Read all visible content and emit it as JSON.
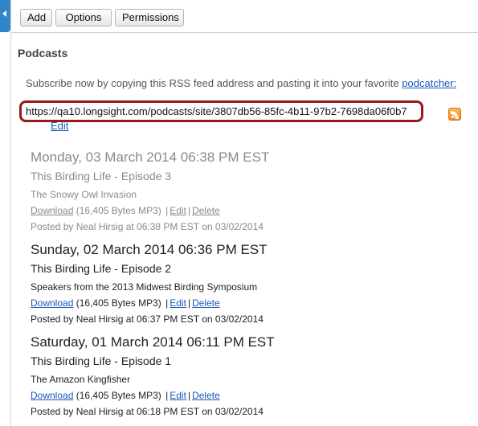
{
  "toolbar": {
    "add_label": "Add",
    "options_label": "Options",
    "permissions_label": "Permissions"
  },
  "page": {
    "title": "Podcasts"
  },
  "subscribe": {
    "text": "Subscribe now by copying this RSS feed address and pasting it into your favorite",
    "link_label": "podcatcher:",
    "feed_url": "https://qa10.longsight.com/podcasts/site/3807db56-85fc-4b11-97b2-7698da06f0b7",
    "edit_label": "Edit"
  },
  "icons": {
    "rss": "rss-feed-icon",
    "collapse": "collapse-arrow-icon"
  },
  "colors": {
    "link": "#1a57b8",
    "highlight_border": "#9b1818",
    "side_tab": "#2f86c7",
    "rss": "#ef8a1c"
  },
  "episodes": [
    {
      "date": "Monday, 03 March 2014 06:38 PM EST",
      "title": "This Birding Life - Episode 3",
      "description": "The Snowy Owl Invasion",
      "download_label": "Download",
      "size": "(16,405 Bytes MP3)",
      "edit_label": "Edit",
      "delete_label": "Delete",
      "posted": "Posted by Neal Hirsig at 06:38 PM EST on 03/02/2014"
    },
    {
      "date": "Sunday, 02 March 2014 06:36 PM EST",
      "title": "This Birding Life - Episode 2",
      "description": "Speakers from the 2013 Midwest Birding Symposium",
      "download_label": "Download",
      "size": "(16,405 Bytes MP3)",
      "edit_label": "Edit",
      "delete_label": "Delete",
      "posted": "Posted by Neal Hirsig at 06:37 PM EST on 03/02/2014"
    },
    {
      "date": "Saturday, 01 March 2014 06:11 PM EST",
      "title": "This Birding Life - Episode 1",
      "description": "The Amazon Kingfisher",
      "download_label": "Download",
      "size": "(16,405 Bytes MP3)",
      "edit_label": "Edit",
      "delete_label": "Delete",
      "posted": "Posted by Neal Hirsig at 06:18 PM EST on 03/02/2014"
    }
  ]
}
